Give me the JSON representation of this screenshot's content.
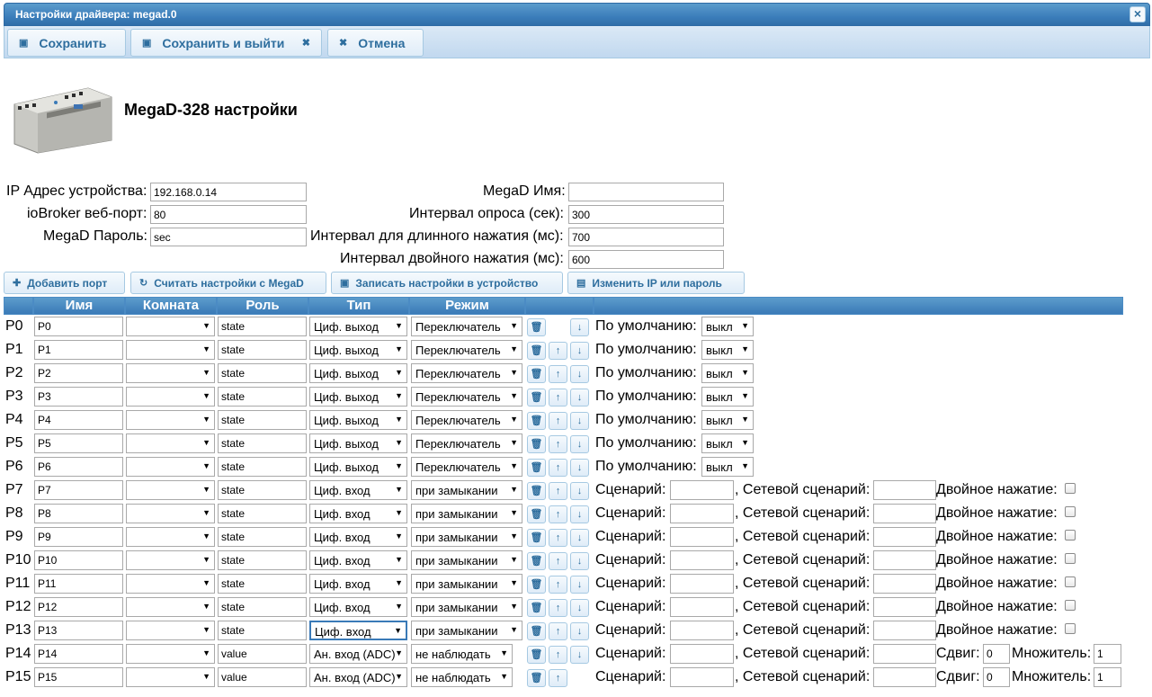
{
  "window": {
    "title": "Настройки драйвера: megad.0",
    "close_glyph": "×"
  },
  "toolbar": {
    "save": "Сохранить",
    "save_exit": "Сохранить и выйти",
    "cancel": "Отмена"
  },
  "device": {
    "title": "MegaD-328 настройки"
  },
  "settings": {
    "ip_label": "IP Адрес устройства:",
    "ip_value": "192.168.0.14",
    "port_label": "ioBroker веб-порт:",
    "port_value": "80",
    "password_label": "MegaD Пароль:",
    "password_value": "sec",
    "name_label": "MegaD Имя:",
    "name_value": "",
    "poll_label": "Интервал опроса (сек):",
    "poll_value": "300",
    "long_label": "Интервал для длинного нажатия (мс):",
    "long_value": "700",
    "double_label": "Интервал двойного нажатия (мс):",
    "double_value": "600"
  },
  "actions": {
    "add_port": "Добавить порт",
    "read_settings": "Считать настройки с MegaD",
    "write_settings": "Записать настройки в устройство",
    "change_ip": "Изменить IP или пароль"
  },
  "table": {
    "headers": {
      "name": "Имя",
      "room": "Комната",
      "role": "Роль",
      "type": "Тип",
      "mode": "Режим"
    }
  },
  "labels": {
    "default": "По умолчанию:",
    "scenario": "Сценарий:",
    "net_scenario": ", Сетевой сценарий:",
    "double_press": "Двойное нажатие:",
    "shift": "Сдвиг:",
    "multiplier": "Множитель:"
  },
  "ports": [
    {
      "label": "P0",
      "name": "P0",
      "room": "",
      "role": "state",
      "type": "Циф. выход",
      "mode": "Переключатель",
      "default": "выкл"
    },
    {
      "label": "P1",
      "name": "P1",
      "room": "",
      "role": "state",
      "type": "Циф. выход",
      "mode": "Переключатель",
      "default": "выкл"
    },
    {
      "label": "P2",
      "name": "P2",
      "room": "",
      "role": "state",
      "type": "Циф. выход",
      "mode": "Переключатель",
      "default": "выкл"
    },
    {
      "label": "P3",
      "name": "P3",
      "room": "",
      "role": "state",
      "type": "Циф. выход",
      "mode": "Переключатель",
      "default": "выкл"
    },
    {
      "label": "P4",
      "name": "P4",
      "room": "",
      "role": "state",
      "type": "Циф. выход",
      "mode": "Переключатель",
      "default": "выкл"
    },
    {
      "label": "P5",
      "name": "P5",
      "room": "",
      "role": "state",
      "type": "Циф. выход",
      "mode": "Переключатель",
      "default": "выкл"
    },
    {
      "label": "P6",
      "name": "P6",
      "room": "",
      "role": "state",
      "type": "Циф. выход",
      "mode": "Переключатель",
      "default": "выкл"
    },
    {
      "label": "P7",
      "name": "P7",
      "room": "",
      "role": "state",
      "type": "Циф. вход",
      "mode": "при замыкании",
      "scenario": "",
      "net_scenario": ""
    },
    {
      "label": "P8",
      "name": "P8",
      "room": "",
      "role": "state",
      "type": "Циф. вход",
      "mode": "при замыкании",
      "scenario": "",
      "net_scenario": ""
    },
    {
      "label": "P9",
      "name": "P9",
      "room": "",
      "role": "state",
      "type": "Циф. вход",
      "mode": "при замыкании",
      "scenario": "",
      "net_scenario": ""
    },
    {
      "label": "P10",
      "name": "P10",
      "room": "",
      "role": "state",
      "type": "Циф. вход",
      "mode": "при замыкании",
      "scenario": "",
      "net_scenario": ""
    },
    {
      "label": "P11",
      "name": "P11",
      "room": "",
      "role": "state",
      "type": "Циф. вход",
      "mode": "при замыкании",
      "scenario": "",
      "net_scenario": ""
    },
    {
      "label": "P12",
      "name": "P12",
      "room": "",
      "role": "state",
      "type": "Циф. вход",
      "mode": "при замыкании",
      "scenario": "",
      "net_scenario": ""
    },
    {
      "label": "P13",
      "name": "P13",
      "room": "",
      "role": "state",
      "type": "Циф. вход",
      "mode": "при замыкании",
      "scenario": "",
      "net_scenario": ""
    },
    {
      "label": "P14",
      "name": "P14",
      "room": "",
      "role": "value",
      "type": "Ан. вход (ADC)",
      "mode": "не наблюдать",
      "scenario": "",
      "net_scenario": "",
      "shift": "0",
      "multiplier": "1"
    },
    {
      "label": "P15",
      "name": "P15",
      "room": "",
      "role": "value",
      "type": "Ан. вход (ADC)",
      "mode": "не наблюдать",
      "scenario": "",
      "net_scenario": "",
      "shift": "0",
      "multiplier": "1"
    }
  ],
  "colors": {
    "accent": "#3a7ab7",
    "button_text": "#2e6e9e",
    "toolbar_bg": "#c1d8ef"
  },
  "icons": {
    "save": "floppy-icon",
    "cancel": "close-icon",
    "add": "plus-icon",
    "read": "refresh-icon",
    "write": "floppy-icon",
    "change": "list-icon",
    "delete": "trash-icon",
    "up": "arrow-up-icon",
    "down": "arrow-down-icon"
  }
}
